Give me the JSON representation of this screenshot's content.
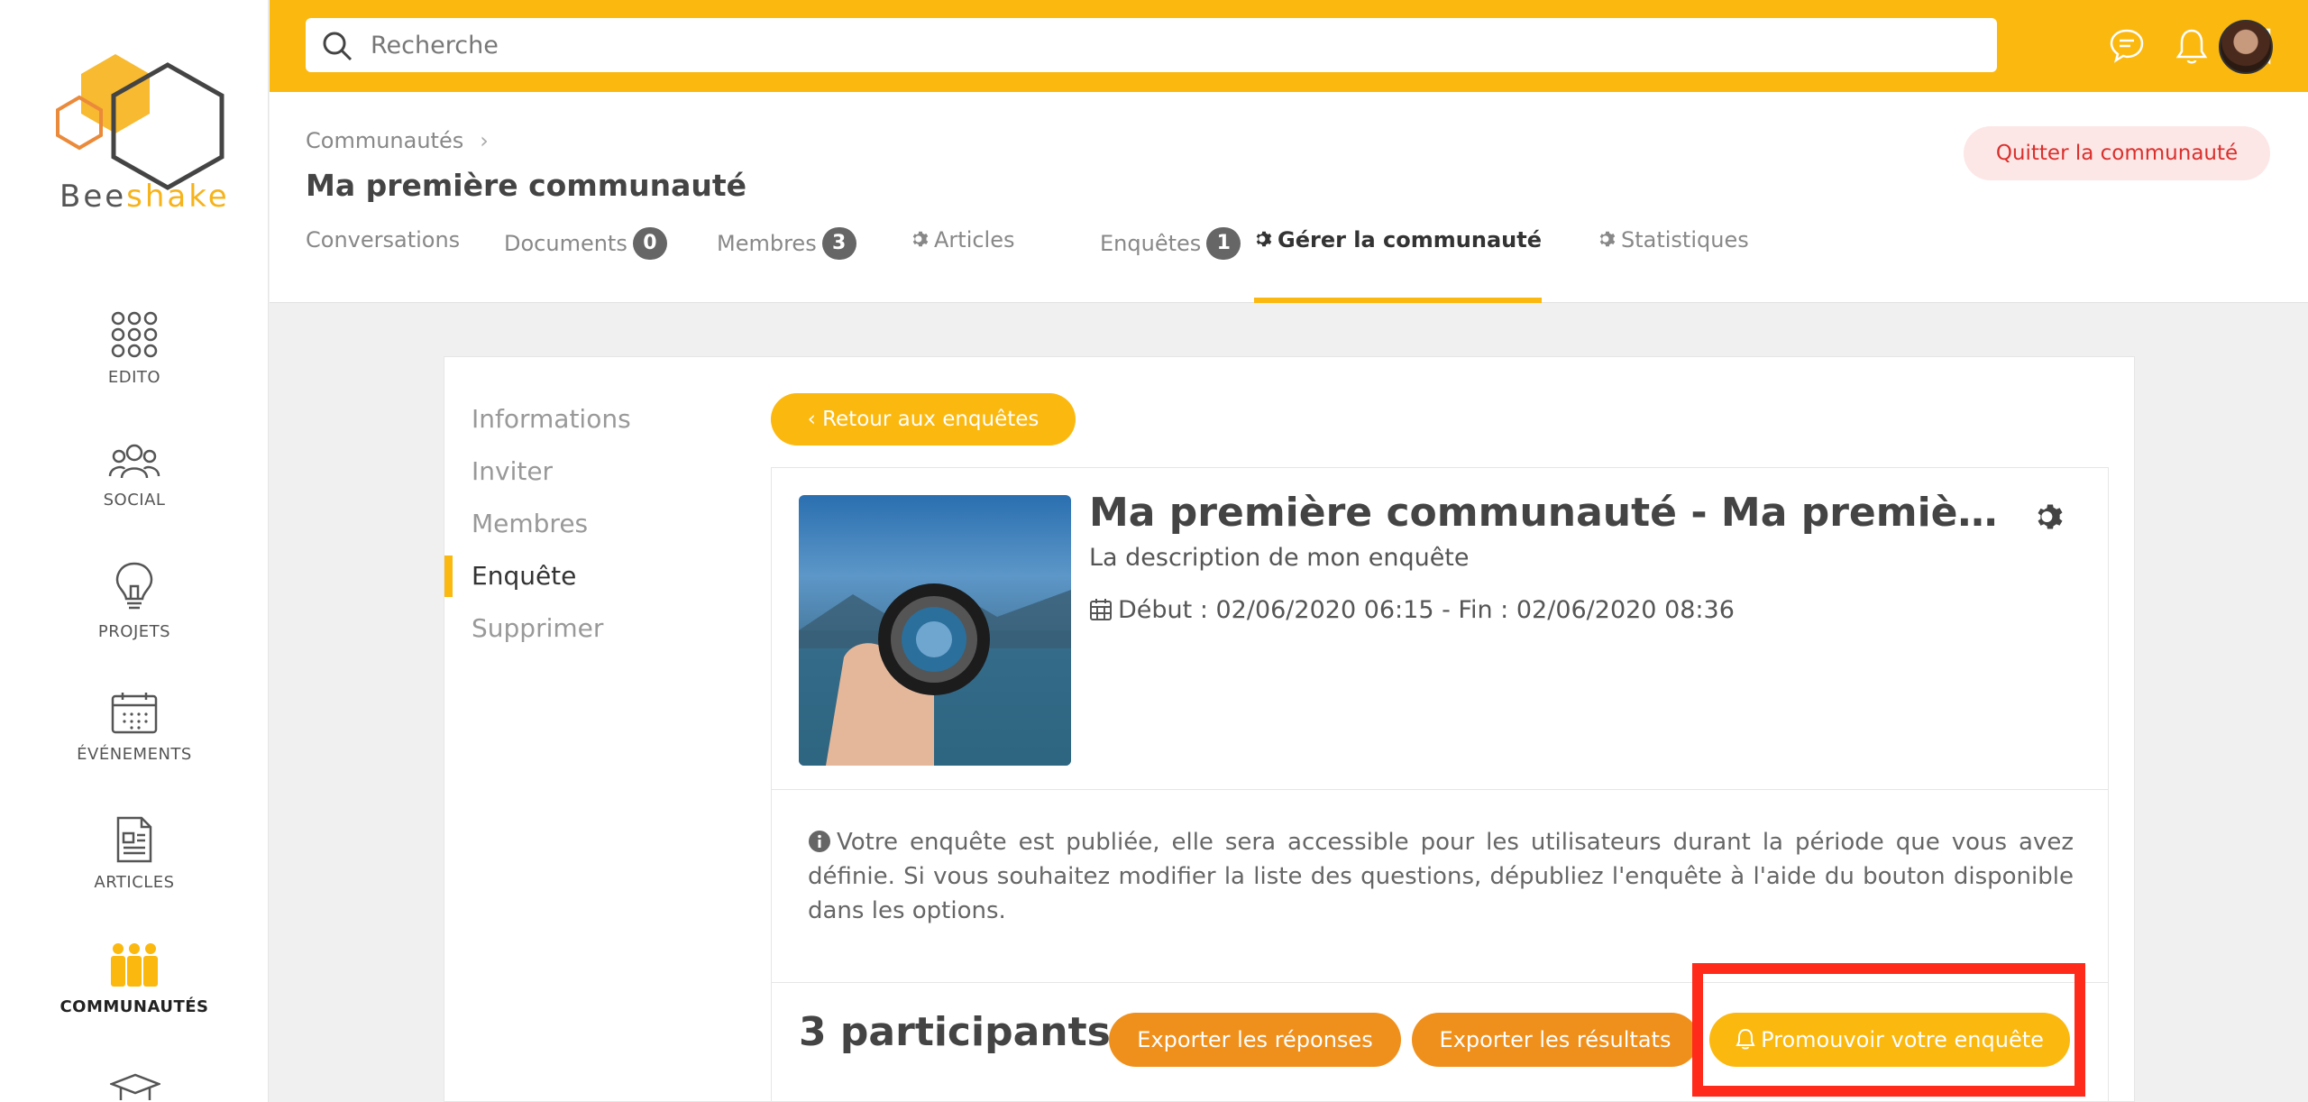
{
  "brand": {
    "name_part1": "Bee",
    "name_part2": "shake"
  },
  "sidebar": {
    "items": [
      {
        "label": "EDITO",
        "icon": "grid-dots-icon"
      },
      {
        "label": "SOCIAL",
        "icon": "people-icon"
      },
      {
        "label": "PROJETS",
        "icon": "lightbulb-icon"
      },
      {
        "label": "ÉVÉNEMENTS",
        "icon": "calendar-icon"
      },
      {
        "label": "ARTICLES",
        "icon": "document-icon"
      },
      {
        "label": "COMMUNAUTÉS",
        "icon": "community-icon",
        "active": true
      }
    ]
  },
  "topbar": {
    "search_placeholder": "Recherche"
  },
  "header": {
    "breadcrumb": "Communautés",
    "title": "Ma première communauté",
    "quit_label": "Quitter la communauté",
    "tabs": [
      {
        "label": "Conversations"
      },
      {
        "label": "Documents",
        "count": "0"
      },
      {
        "label": "Membres",
        "count": "3"
      },
      {
        "label": "Articles"
      },
      {
        "label": "Enquêtes",
        "count": "1"
      },
      {
        "label": "Gérer la communauté",
        "active": true
      },
      {
        "label": "Statistiques"
      }
    ]
  },
  "subnav": {
    "items": [
      {
        "label": "Informations"
      },
      {
        "label": "Inviter"
      },
      {
        "label": "Membres"
      },
      {
        "label": "Enquête",
        "active": true
      },
      {
        "label": "Supprimer"
      }
    ]
  },
  "survey": {
    "back_label": "Retour aux enquêtes",
    "title": "Ma première communauté - Ma première communauté",
    "description": "La description de mon enquête",
    "dates": "Début : 02/06/2020 06:15 - Fin : 02/06/2020 08:36",
    "notice": "Votre enquête est publiée, elle sera accessible pour les utilisateurs durant la période que vous avez définie. Si vous souhaitez modifier la liste des questions, dépubliez l'enquête à l'aide du bouton disponible dans les options.",
    "participants": "3 participants",
    "export_answers": "Exporter les réponses",
    "export_results": "Exporter les résultats",
    "promote": "Promouvoir votre enquête"
  },
  "colors": {
    "accent": "#fbb80f",
    "orange": "#f0901c",
    "danger": "#d9302c",
    "highlight": "#ff2a1a"
  }
}
